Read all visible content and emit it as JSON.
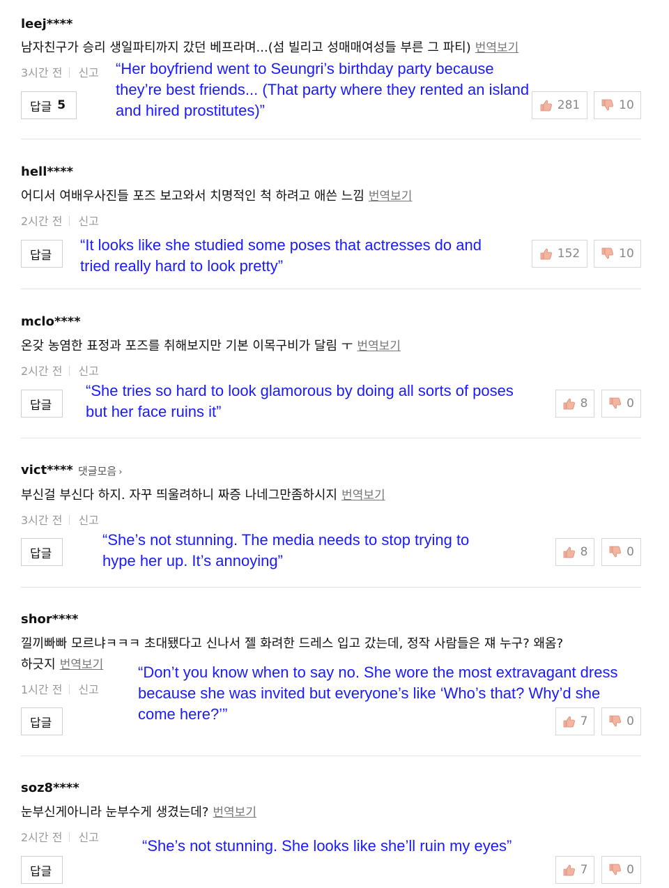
{
  "common": {
    "translate_label": "번역보기",
    "report_label": "신고",
    "reply_label": "답글",
    "collect_label": "댓글모음"
  },
  "comments": [
    {
      "user": "leej****",
      "text": "남자친구가 승리 생일파티까지 갔던 베프라며...(섬 빌리고 성매매여성들 부른 그 파티)",
      "time": "3시간 전",
      "reply_count": "5",
      "likes": "281",
      "dislikes": "10",
      "translation": [
        "“Her boyfriend went to Seungri’s birthday party because",
        "they’re best friends... (That party where they rented an island",
        "and hired prostitutes)”"
      ]
    },
    {
      "user": "hell****",
      "text": "어디서 여배우사진들 포즈 보고와서 치명적인 척 하려고 애쓴 느낌",
      "time": "2시간 전",
      "likes": "152",
      "dislikes": "10",
      "translation": [
        "“It looks like she studied some poses that actresses do and",
        "tried really hard to look pretty”"
      ]
    },
    {
      "user": "mclo****",
      "text": "온갖 농염한 표정과 포즈를 취해보지만 기본 이목구비가 달림 ㅜ",
      "time": "2시간 전",
      "likes": "8",
      "dislikes": "0",
      "translation": [
        "“She tries so hard to look glamorous by doing all sorts of poses",
        "but her face ruins it”"
      ]
    },
    {
      "user": "vict****",
      "text": "부신걸 부신다 하지. 자꾸 띄울려하니 짜증 나네그만좀하시지",
      "time": "3시간 전",
      "likes": "8",
      "dislikes": "0",
      "translation": [
        "“She’s not stunning. The media needs to stop trying to",
        "hype her up. It’s annoying”"
      ]
    },
    {
      "user": "shor****",
      "text": "낄끼빠빠 모르냐ㅋㅋㅋ 초대됐다고 신나서 젤 화려한 드레스 입고 갔는데, 정작 사람들은 쟤 누구? 왜옴?",
      "text2": "하긋지",
      "time": "1시간 전",
      "likes": "7",
      "dislikes": "0",
      "translation": [
        "“Don’t you know when to say no. She wore the most extravagant dress",
        "because she was invited but everyone’s like ‘Who’s that? Why’d she",
        "come here?’”"
      ]
    },
    {
      "user": "soz8****",
      "text": "눈부신게아니라 눈부수게 생겼는데?",
      "time": "2시간 전",
      "likes": "7",
      "dislikes": "0",
      "translation": [
        "“She’s not stunning. She looks like she’ll ruin my eyes”"
      ]
    }
  ],
  "icons": {
    "like": "thumbs-up-icon",
    "dislike": "thumbs-down-icon",
    "chevron": "chevron-right-icon"
  },
  "colors": {
    "translation": "#1a1aff",
    "meta": "#999999",
    "thumb_up": "#f2b7a3",
    "thumb_down": "#f2b7a3"
  }
}
